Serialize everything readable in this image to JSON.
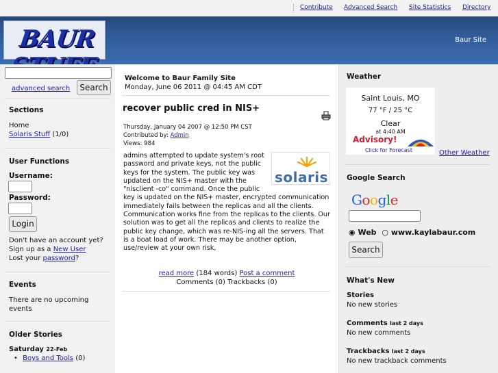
{
  "topnav": {
    "links": [
      "Contribute",
      "Advanced Search",
      "Site Statistics",
      "Directory"
    ]
  },
  "banner": {
    "logo": "BAUR STUFF",
    "site_name": "Baur Site"
  },
  "left": {
    "search_value": "",
    "advanced_search": "advanced search",
    "search_button": "Search",
    "sections_title": "Sections",
    "sections_home": "Home",
    "sections_solaris": "Solaris Stuff",
    "sections_solaris_count": "(1/0)",
    "user_functions_title": "User Functions",
    "username_label": "Username:",
    "password_label": "Password:",
    "login_button": "Login",
    "no_account": "Don't have an account yet?",
    "signup_prefix": "Sign up as a",
    "new_user": "New User",
    "lost_prefix": "Lost your",
    "password_link": "password",
    "lost_suffix": "?",
    "events_title": "Events",
    "events_text_1": "There are no upcoming",
    "events_text_2": "events",
    "older_title": "Older Stories",
    "older_date": "Saturday",
    "older_date_small": "22-Feb",
    "older_item": "Boys and Tools",
    "older_item_count": "(0)"
  },
  "center": {
    "welcome": "Welcome to Baur Family Site",
    "datetime": "Monday, June 06 2011 @ 04:45 AM CDT",
    "article_title": "recover public cred in NIS+",
    "article_date": "Thursday, January 04 2007 @ 12:50 PM CST",
    "contributed_prefix": "Contributed by:",
    "contributed_by": "Admin",
    "views": "Views: 984",
    "solaris_logo": "solaris",
    "body": "admins attempted to update system's root password and private keys, not the public keys for the system. The public key was updated on the NIS+ master with the \"nisclient -co\" command. Once the public key is updated on the NIS+ master, encrypted communication immediately fails between the replicas and all the clients. Communication works fine from the replicas to the clients. Our solution was to get all the replicas and clients to realize the public key change, which was re-NIS-ing all the servers. That is a boat load of work. There may be another option, use/review at your own risk,",
    "read_more": "read more",
    "word_count": "(184 words)",
    "post_comment": "Post a comment",
    "comments_line": "Comments (0) Trackbacks (0)"
  },
  "right": {
    "weather_title": "Weather",
    "weather_city": "Saint Louis, MO",
    "weather_temp": "77 °F / 25 °C",
    "weather_cond": "Clear",
    "weather_time": "at 4:40 AM",
    "weather_advisory": "Advisory!",
    "weather_forecast": "Click for Forecast",
    "other_weather": "Other Weather",
    "google_title": "Google Search",
    "google_query": "",
    "radio_web": "Web",
    "radio_site": "www.kaylabaur.com",
    "google_button": "Search",
    "whatsnew_title": "What's New",
    "stories_label": "Stories",
    "stories_text": "No new stories",
    "comments_label": "Comments",
    "comments_small": "last 2 days",
    "comments_text": "No new comments",
    "trackbacks_label": "Trackbacks",
    "trackbacks_small": "last 2 days",
    "trackbacks_text": "No new trackback comments"
  },
  "colors": {
    "banner": "#2f5a96",
    "link": "#1a1aa6",
    "advisory": "#e0142a"
  }
}
